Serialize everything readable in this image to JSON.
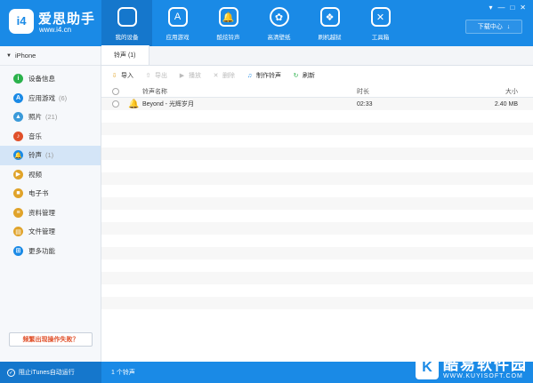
{
  "app": {
    "logo_text": "i4",
    "name": "爱思助手",
    "url": "www.i4.cn"
  },
  "nav": [
    {
      "label": "我的设备",
      "icon": "apple-icon",
      "glyph": "",
      "active": true
    },
    {
      "label": "应用游戏",
      "icon": "app-store-icon",
      "glyph": "A"
    },
    {
      "label": "酷炫铃声",
      "icon": "bell-icon",
      "glyph": "🔔"
    },
    {
      "label": "高清壁纸",
      "icon": "flower-icon",
      "glyph": "✿"
    },
    {
      "label": "刷机越狱",
      "icon": "box-icon",
      "glyph": "❖"
    },
    {
      "label": "工具箱",
      "icon": "tools-icon",
      "glyph": "✕"
    }
  ],
  "window": {
    "controls": [
      "▾",
      "—",
      "□",
      "✕"
    ],
    "download_label": "下载中心",
    "download_icon": "↓"
  },
  "sidebar": {
    "device": "iPhone",
    "items": [
      {
        "label": "设备信息",
        "count": "",
        "icon": "info-icon",
        "glyph": "i",
        "color": "#2bb24c"
      },
      {
        "label": "应用游戏",
        "count": "(6)",
        "icon": "apps-icon",
        "glyph": "A",
        "color": "#1a8ae6"
      },
      {
        "label": "照片",
        "count": "(21)",
        "icon": "photo-icon",
        "glyph": "▲",
        "color": "#3a9ad9"
      },
      {
        "label": "音乐",
        "count": "",
        "icon": "music-icon",
        "glyph": "♪",
        "color": "#e0502a"
      },
      {
        "label": "铃声",
        "count": "(1)",
        "icon": "bell-icon",
        "glyph": "🔔",
        "color": "#1a8ae6",
        "active": true
      },
      {
        "label": "视频",
        "count": "",
        "icon": "video-icon",
        "glyph": "▶",
        "color": "#e0a32a"
      },
      {
        "label": "电子书",
        "count": "",
        "icon": "book-icon",
        "glyph": "■",
        "color": "#e0a32a"
      },
      {
        "label": "资料管理",
        "count": "",
        "icon": "contacts-icon",
        "glyph": "≡",
        "color": "#e0a32a"
      },
      {
        "label": "文件管理",
        "count": "",
        "icon": "folder-icon",
        "glyph": "▤",
        "color": "#e0a32a"
      },
      {
        "label": "更多功能",
        "count": "",
        "icon": "more-icon",
        "glyph": "⊞",
        "color": "#1a8ae6"
      }
    ],
    "help_label": "频繁出现操作失败？"
  },
  "tab": {
    "label": "铃声 (1)"
  },
  "toolbar": [
    {
      "label": "导入",
      "icon": "import-icon",
      "glyph": "⇩",
      "color": "#e0a32a",
      "disabled": false
    },
    {
      "label": "导出",
      "icon": "export-icon",
      "glyph": "⇧",
      "color": "#bbb",
      "disabled": true
    },
    {
      "label": "播放",
      "icon": "play-icon",
      "glyph": "▶",
      "color": "#bbb",
      "disabled": true
    },
    {
      "label": "删除",
      "icon": "delete-icon",
      "glyph": "✕",
      "color": "#bbb",
      "disabled": true
    },
    {
      "label": "制作铃声",
      "icon": "make-ringtone-icon",
      "glyph": "♫",
      "color": "#1a8ae6",
      "disabled": false
    },
    {
      "label": "刷新",
      "icon": "refresh-icon",
      "glyph": "↻",
      "color": "#2bb24c",
      "disabled": false
    }
  ],
  "table": {
    "columns": {
      "name": "铃声名称",
      "duration": "时长",
      "size": "大小"
    },
    "rows": [
      {
        "name": "Beyond - 光辉岁月",
        "duration": "02:33",
        "size": "2.40 MB"
      }
    ],
    "empty_rows": 17
  },
  "status": {
    "itunes_label": "阻止iTunes自动运行",
    "count_label": "1 个铃声"
  },
  "watermark": {
    "title": "酷易软件园",
    "url": "WWW.KUYISOFT.COM"
  }
}
